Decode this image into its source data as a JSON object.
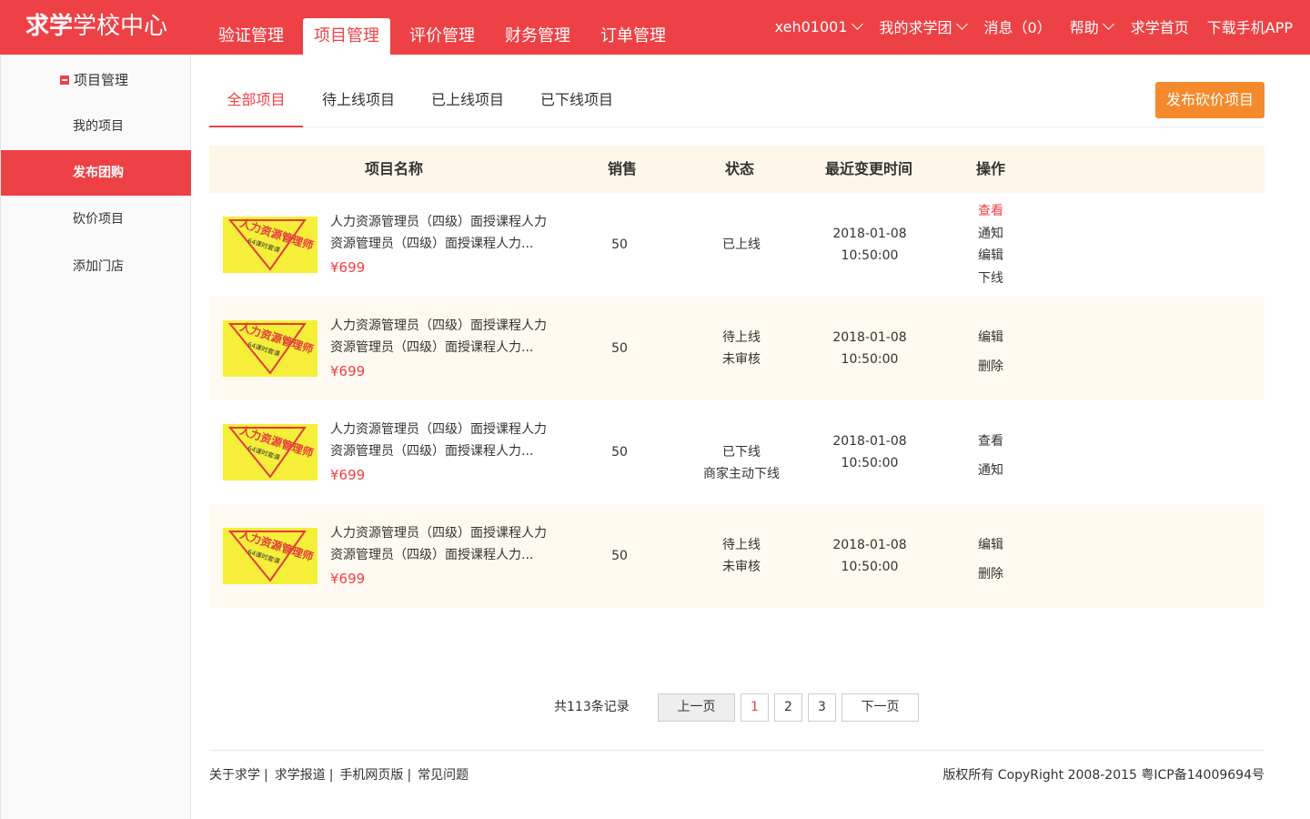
{
  "header": {
    "logo_bold": "求学",
    "logo_rest": "学校中心",
    "nav": [
      "验证管理",
      "项目管理",
      "评价管理",
      "财务管理",
      "订单管理"
    ],
    "active_nav": 1,
    "user": "xeh01001",
    "my_group": "我的求学团",
    "messages": "消息（0）",
    "help": "帮助",
    "home": "求学首页",
    "app": "下载手机APP"
  },
  "sidebar": {
    "title": "项目管理",
    "items": [
      "我的项目",
      "发布团购",
      "砍价项目",
      "添加门店"
    ],
    "active": 1
  },
  "tabs": {
    "items": [
      "全部项目",
      "待上线项目",
      "已上线项目",
      "已下线项目"
    ],
    "active": 0,
    "publish_button": "发布砍价项目"
  },
  "table": {
    "headers": [
      "项目名称",
      "销售",
      "状态",
      "最近变更时间",
      "操作"
    ],
    "rows": [
      {
        "name_line1": "人力资源管理员（四级）面授课程人力",
        "name_line2": "资源管理员（四级）面授课程人力...",
        "price": "¥699",
        "sales": "50",
        "status": [
          "已上线"
        ],
        "date": "2018-01-08",
        "time": "10:50:00",
        "ops": [
          "查看",
          "通知",
          "编辑",
          "下线"
        ]
      },
      {
        "name_line1": "人力资源管理员（四级）面授课程人力",
        "name_line2": "资源管理员（四级）面授课程人力...",
        "price": "¥699",
        "sales": "50",
        "status": [
          "待上线",
          "未审核"
        ],
        "date": "2018-01-08",
        "time": "10:50:00",
        "ops": [
          "编辑",
          "删除"
        ]
      },
      {
        "name_line1": "人力资源管理员（四级）面授课程人力",
        "name_line2": "资源管理员（四级）面授课程人力...",
        "price": "¥699",
        "sales": "50",
        "status": [
          "已下线",
          "商家主动下线"
        ],
        "date": "2018-01-08",
        "time": "10:50:00",
        "ops": [
          "查看",
          "通知"
        ]
      },
      {
        "name_line1": "人力资源管理员（四级）面授课程人力",
        "name_line2": "资源管理员（四级）面授课程人力...",
        "price": "¥699",
        "sales": "50",
        "status": [
          "待上线",
          "未审核"
        ],
        "date": "2018-01-08",
        "time": "10:50:00",
        "ops": [
          "编辑",
          "删除"
        ]
      }
    ],
    "thumb_text": "人力资源管理师",
    "thumb_sub": "64课时套课"
  },
  "pagination": {
    "total": "共113条记录",
    "prev": "上一页",
    "pages": [
      "1",
      "2",
      "3"
    ],
    "current": "1",
    "next": "下一页"
  },
  "footer": {
    "links": [
      "关于求学",
      "求学报道",
      "手机网页版",
      "常见问题"
    ],
    "copyright": "版权所有 CopyRight 2008-2015 粤ICP备14009694号"
  },
  "colors": {
    "brand": "#ee4145",
    "accent": "#f48a2c",
    "row_alt": "#fefaf1"
  }
}
